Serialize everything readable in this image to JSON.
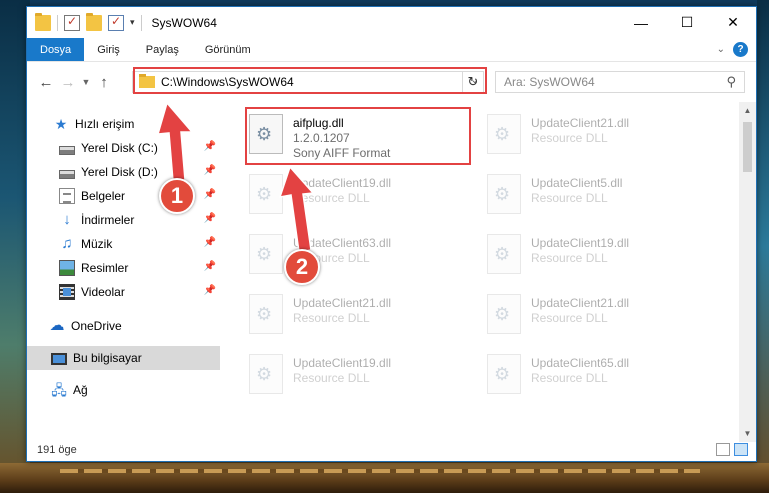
{
  "window": {
    "title": "SysWOW64",
    "controls": [
      "minimize",
      "maximize",
      "close"
    ]
  },
  "ribbon": {
    "tabs": [
      {
        "label": "Dosya",
        "active": true
      },
      {
        "label": "Giriş"
      },
      {
        "label": "Paylaş"
      },
      {
        "label": "Görünüm"
      }
    ]
  },
  "navigation": {
    "address": "C:\\Windows\\SysWOW64",
    "search_placeholder": "Ara: SysWOW64"
  },
  "sidebar": {
    "items": [
      {
        "label": "Hızlı erişim",
        "icon": "star-icon"
      },
      {
        "label": "Yerel Disk (C:)",
        "icon": "drive-icon",
        "pinned": true
      },
      {
        "label": "Yerel Disk (D:)",
        "icon": "drive-icon",
        "pinned": true
      },
      {
        "label": "Belgeler",
        "icon": "documents-icon",
        "pinned": true
      },
      {
        "label": "İndirmeler",
        "icon": "downloads-icon",
        "pinned": true
      },
      {
        "label": "Müzik",
        "icon": "music-icon",
        "pinned": true
      },
      {
        "label": "Resimler",
        "icon": "pictures-icon",
        "pinned": true
      },
      {
        "label": "Videolar",
        "icon": "videos-icon",
        "pinned": true
      },
      {
        "label": "OneDrive",
        "icon": "onedrive-icon"
      },
      {
        "label": "Bu bilgisayar",
        "icon": "this-pc-icon",
        "selected": true
      },
      {
        "label": "Ağ",
        "icon": "network-icon"
      }
    ]
  },
  "files": [
    {
      "name": "aifplug.dll",
      "line2": "1.2.0.1207",
      "line3": "Sony AIFF Format",
      "highlighted": true
    },
    {
      "name": "UpdateClient21.dll",
      "line2": "Resource DLL"
    },
    {
      "name": "UpdateClient19.dll",
      "line2": "Resource DLL"
    },
    {
      "name": "UpdateClient5.dll",
      "line2": "Resource DLL"
    },
    {
      "name": "UpdateClient63.dll",
      "line2": "Resource DLL"
    },
    {
      "name": "UpdateClient19.dll",
      "line2": "Resource DLL"
    },
    {
      "name": "UpdateClient21.dll",
      "line2": "Resource DLL"
    },
    {
      "name": "UpdateClient21.dll",
      "line2": "Resource DLL"
    },
    {
      "name": "UpdateClient19.dll",
      "line2": "Resource DLL"
    },
    {
      "name": "UpdateClient65.dll",
      "line2": "Resource DLL"
    }
  ],
  "status": {
    "item_count": "191 öge"
  },
  "annotations": {
    "badge1": "1",
    "badge2": "2",
    "highlight_color": "#e34242"
  }
}
